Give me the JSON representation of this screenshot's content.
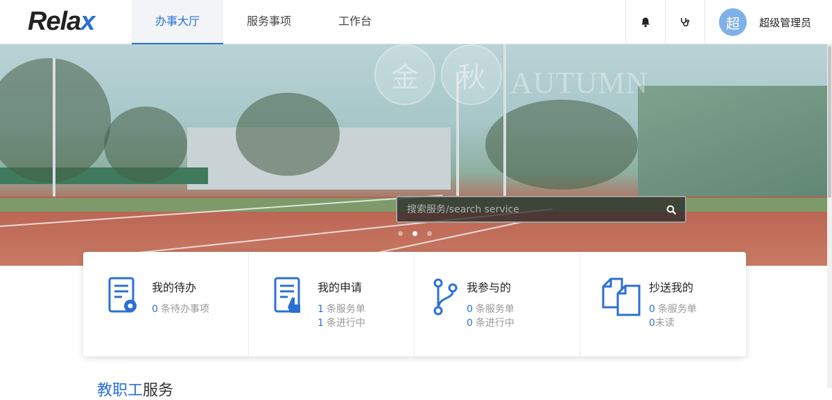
{
  "header": {
    "logo": {
      "main": "Rela",
      "accent": "x"
    },
    "tabs": [
      {
        "label": "办事大厅",
        "active": true
      },
      {
        "label": "服务事项",
        "active": false
      },
      {
        "label": "工作台",
        "active": false
      }
    ],
    "icons": [
      "bell-icon",
      "stethoscope-icon"
    ],
    "user": {
      "avatar_text": "超",
      "name": "超级管理员"
    }
  },
  "banner": {
    "watermark": {
      "char1": "金",
      "char2": "秋",
      "text": "AUTUMN"
    },
    "search_placeholder": "搜索服务/search service",
    "slides": {
      "count": 3,
      "active_index": 1
    }
  },
  "cards": [
    {
      "icon": "todo-doc-gear-icon",
      "title": "我的待办",
      "lines": [
        {
          "num": "0",
          "text": "条待办事项"
        }
      ]
    },
    {
      "icon": "apply-doc-hand-icon",
      "title": "我的申请",
      "lines": [
        {
          "num": "1",
          "text": "条服务单"
        },
        {
          "num": "1",
          "text": "条进行中"
        }
      ]
    },
    {
      "icon": "branch-flow-icon",
      "title": "我参与的",
      "lines": [
        {
          "num": "0",
          "text": "条服务单"
        },
        {
          "num": "0",
          "text": "条进行中"
        }
      ]
    },
    {
      "icon": "copy-docs-icon",
      "title": "抄送我的",
      "lines": [
        {
          "num": "0",
          "text": "条服务单"
        },
        {
          "num": "0",
          "text": "未读"
        }
      ]
    }
  ],
  "section": {
    "title_highlight": "教职工",
    "title_rest": "服务"
  },
  "colors": {
    "accent": "#2a6fd6",
    "avatar": "#7fb0e8"
  }
}
